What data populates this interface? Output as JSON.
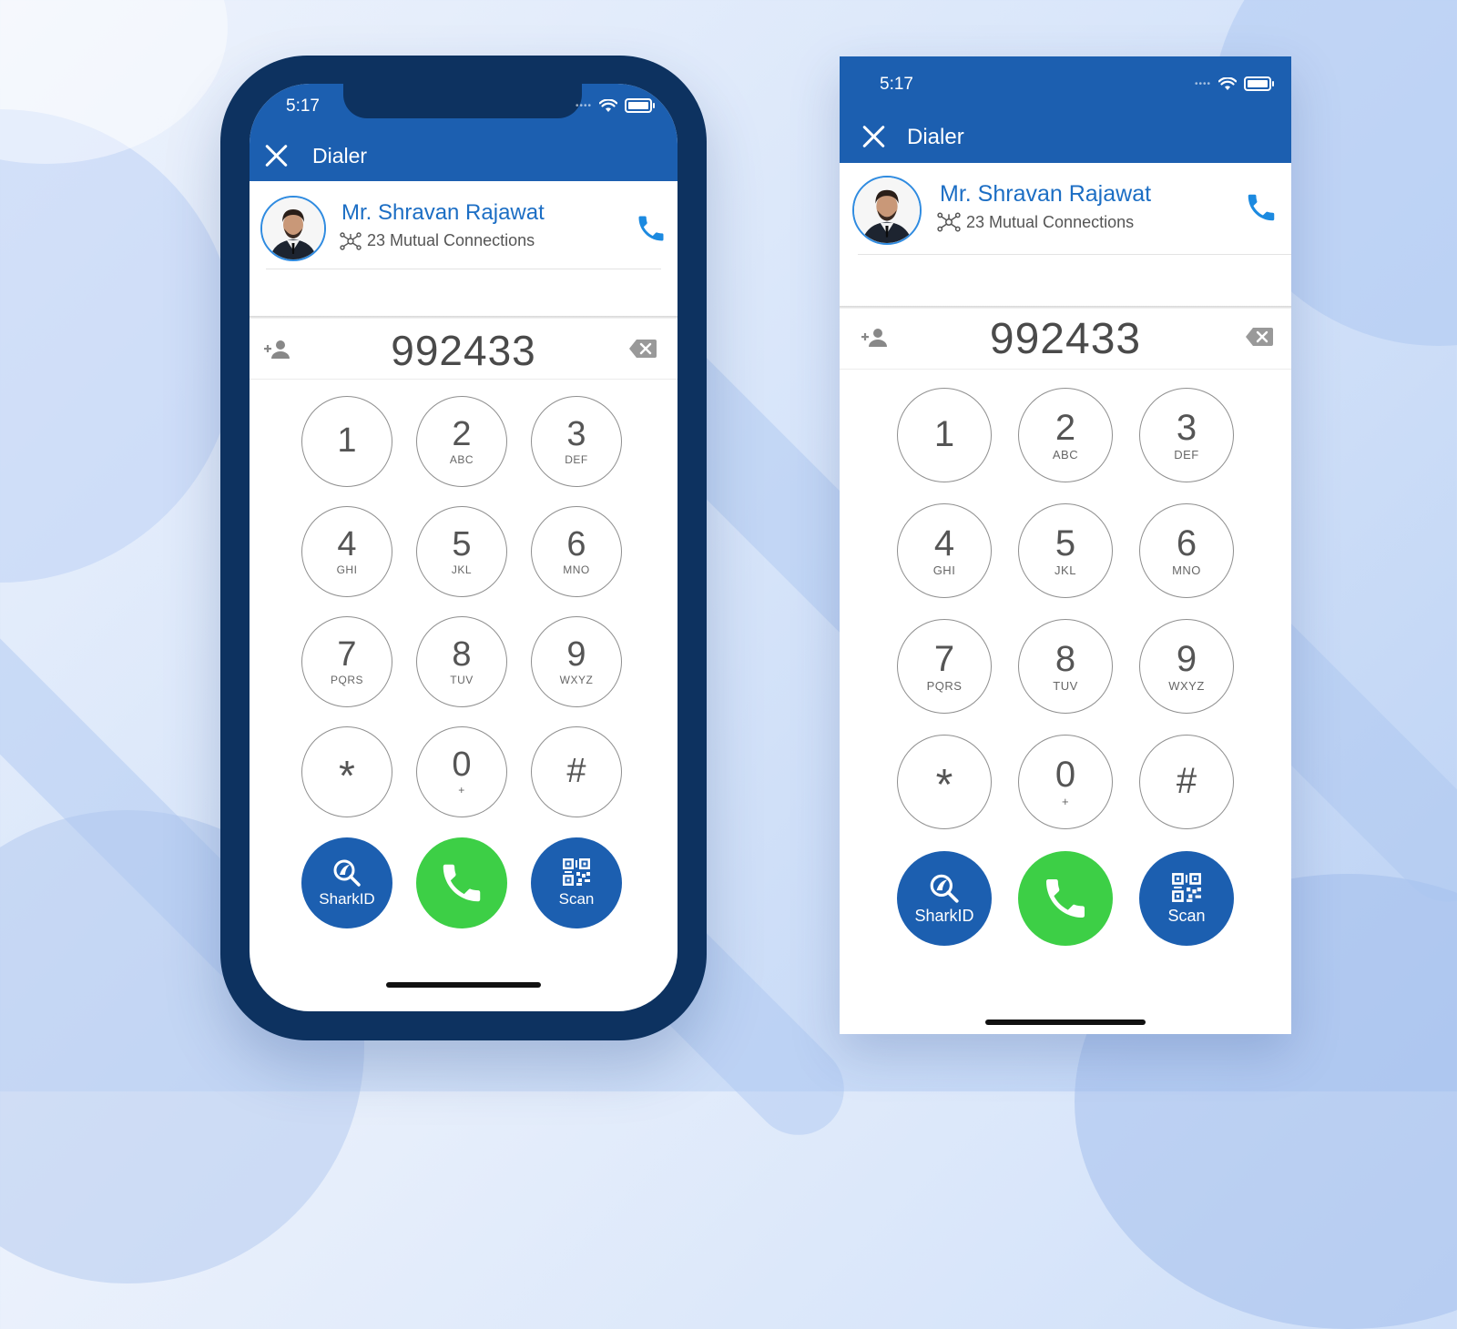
{
  "colors": {
    "primary": "#1c5fb0",
    "name_blue": "#1c6ec4",
    "call_green": "#3dcf46",
    "frame": "#0d3260"
  },
  "screens": [
    {
      "status_time": "5:17",
      "appbar_title": "Dialer",
      "contact_name": "Mr. Shravan Rajawat",
      "mutual_connections": "23 Mutual Connections",
      "dialed_number": "992433",
      "keys": [
        {
          "digit": "1",
          "letters": ""
        },
        {
          "digit": "2",
          "letters": "ABC"
        },
        {
          "digit": "3",
          "letters": "DEF"
        },
        {
          "digit": "4",
          "letters": "GHI"
        },
        {
          "digit": "5",
          "letters": "JKL"
        },
        {
          "digit": "6",
          "letters": "MNO"
        },
        {
          "digit": "7",
          "letters": "PQRS"
        },
        {
          "digit": "8",
          "letters": "TUV"
        },
        {
          "digit": "9",
          "letters": "WXYZ"
        },
        {
          "digit": "*",
          "letters": ""
        },
        {
          "digit": "0",
          "letters": "+"
        },
        {
          "digit": "#",
          "letters": ""
        }
      ],
      "actions": {
        "sharkid_label": "SharkID",
        "scan_label": "Scan"
      }
    },
    {
      "status_time": "5:17",
      "appbar_title": "Dialer",
      "contact_name": "Mr. Shravan Rajawat",
      "mutual_connections": "23 Mutual Connections",
      "dialed_number": "992433",
      "keys": [
        {
          "digit": "1",
          "letters": ""
        },
        {
          "digit": "2",
          "letters": "ABC"
        },
        {
          "digit": "3",
          "letters": "DEF"
        },
        {
          "digit": "4",
          "letters": "GHI"
        },
        {
          "digit": "5",
          "letters": "JKL"
        },
        {
          "digit": "6",
          "letters": "MNO"
        },
        {
          "digit": "7",
          "letters": "PQRS"
        },
        {
          "digit": "8",
          "letters": "TUV"
        },
        {
          "digit": "9",
          "letters": "WXYZ"
        },
        {
          "digit": "*",
          "letters": ""
        },
        {
          "digit": "0",
          "letters": "+"
        },
        {
          "digit": "#",
          "letters": ""
        }
      ],
      "actions": {
        "sharkid_label": "SharkID",
        "scan_label": "Scan"
      }
    }
  ]
}
